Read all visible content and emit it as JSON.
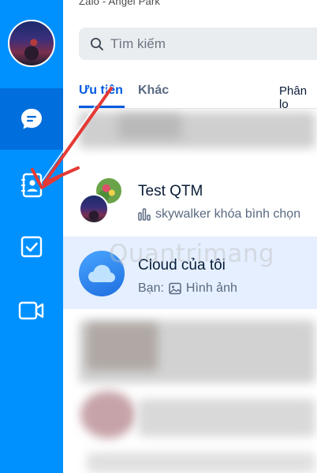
{
  "window": {
    "title": "Zalo - Angel Park"
  },
  "search": {
    "placeholder": "Tìm kiếm"
  },
  "tabs": {
    "priority": "Ưu tiên",
    "other": "Khác",
    "classify": "Phân lo"
  },
  "conversations": [
    {
      "name": "Test QTM",
      "preview": "skywalker khóa bình chọn"
    },
    {
      "name": "Cloud của tôi",
      "preview_prefix": "Bạn:",
      "preview": "Hình ảnh"
    }
  ],
  "watermark": "Quantrimang",
  "sidebar": {
    "items": [
      {
        "name": "messages",
        "icon": "chat-bubble-icon",
        "active": true
      },
      {
        "name": "contacts",
        "icon": "contact-book-icon",
        "active": false
      },
      {
        "name": "todo",
        "icon": "checkbox-icon",
        "active": false
      },
      {
        "name": "video-call",
        "icon": "video-camera-icon",
        "active": false
      }
    ]
  },
  "colors": {
    "sidebar": "#0091ff",
    "sidebar_active": "#006edc",
    "accent": "#005ae0",
    "annotation_arrow": "#e53935"
  }
}
